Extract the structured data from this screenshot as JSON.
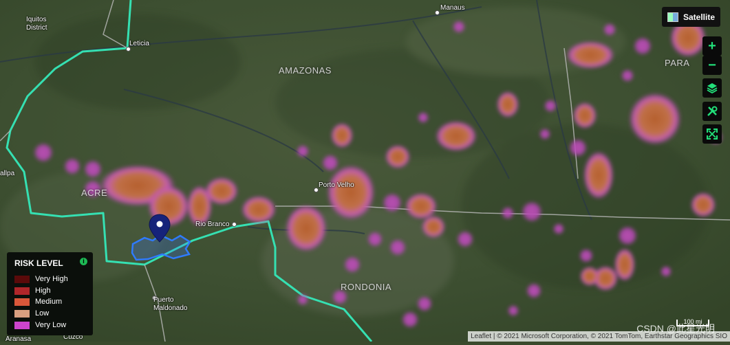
{
  "labels": {
    "iquitos": "Iquitos\nDistrict",
    "leticia": "Leticia",
    "manaus": "Manaus",
    "amazonas": "AMAZONAS",
    "para": "PARA",
    "acre": "ACRE",
    "porto_velho": "Porto Velho",
    "rio_branco": "Rio Branco",
    "rondonia": "RONDONIA",
    "puerto_maldonado": "Puerto\nMaldonado",
    "cuzco": "Cuzco",
    "allpa": "allpa",
    "arequipa_partial": "Aranasa"
  },
  "layer_button": {
    "label": "Satellite",
    "icon": "satellite-layer-icon"
  },
  "controls": [
    {
      "name": "zoom-in-button",
      "glyph": "+"
    },
    {
      "name": "zoom-out-button",
      "glyph": "−"
    },
    {
      "name": "layers-button",
      "glyph": "layers-icon"
    },
    {
      "name": "tools-button",
      "glyph": "tools-icon"
    },
    {
      "name": "fullscreen-button",
      "glyph": "fullscreen-icon"
    }
  ],
  "legend": {
    "title": "RISK LEVEL",
    "items": [
      {
        "label": "Very High",
        "color": "#5a0a0a"
      },
      {
        "label": "High",
        "color": "#b0262a"
      },
      {
        "label": "Medium",
        "color": "#d9573a"
      },
      {
        "label": "Low",
        "color": "#d9a080"
      },
      {
        "label": "Very Low",
        "color": "#cc44cc"
      }
    ]
  },
  "scale": "100 mi",
  "attribution": "Leaflet | © 2021 Microsoft Corporation, © 2021 TomTom, Earthstar Geographics SIO",
  "watermark": "CSDN @此星光明"
}
